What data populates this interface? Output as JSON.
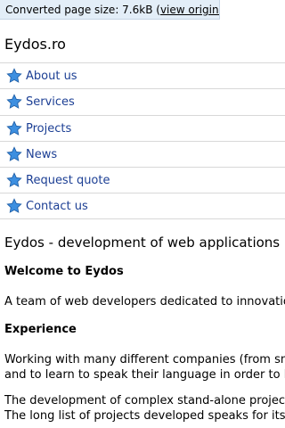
{
  "banner": {
    "prefix": "Converted page size: 7.6kB (",
    "link": "view original",
    "suffix": ")"
  },
  "site_title": "Eydos.ro",
  "nav": {
    "icon": "star-icon",
    "icon_color": "#3d8fe0",
    "link_color": "#1c3f94",
    "items": [
      {
        "label": "About us"
      },
      {
        "label": "Services"
      },
      {
        "label": "Projects"
      },
      {
        "label": "News"
      },
      {
        "label": "Request quote"
      },
      {
        "label": "Contact us"
      }
    ]
  },
  "content": {
    "heading": "Eydos - development of web applications",
    "sections": [
      {
        "title": "Welcome to Eydos",
        "lines": [
          "A team of web developers dedicated to innovation"
        ]
      },
      {
        "title": "Experience",
        "lines": [
          "Working with many different companies (from small",
          "and to learn to speak their language in order to ha"
        ]
      },
      {
        "title": "",
        "lines": [
          "The development of complex stand-alone projects",
          "The long list of projects developed speaks for itsel"
        ]
      }
    ]
  }
}
